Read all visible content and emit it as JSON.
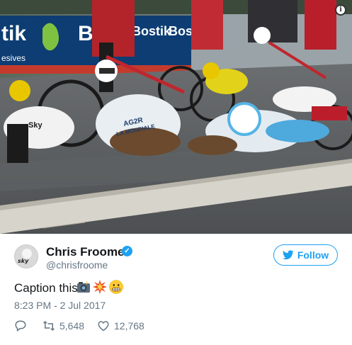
{
  "photo": {
    "alt_visible": "",
    "banner_text_left": "tik",
    "banner_text_bost": "Bost",
    "banner_text_bostik": "Bostik",
    "banner_text_bos": "Bos",
    "banner_sub": "esives",
    "rider_jersey_text_1": "AG2R",
    "rider_jersey_text_2": "LA MONDIALE",
    "rider_jersey_text_3": "Sky"
  },
  "tweet": {
    "author_name": "Chris Froome",
    "author_handle": "@chrisfroome",
    "verified_mark": "✓",
    "avatar_text": "sky",
    "text": "Caption this",
    "timestamp": "8:23 PM - 2 Jul 2017",
    "retweets": "5,648",
    "likes": "12,768"
  },
  "follow_button": {
    "label": "Follow"
  },
  "icons": {
    "info": "info-icon",
    "reply": "reply-icon",
    "retweet": "retweet-icon",
    "like": "heart-icon",
    "twitter": "twitter-bird-icon"
  },
  "colors": {
    "accent": "#1da1f2",
    "secondary_text": "#657786",
    "primary_text": "#14171a"
  }
}
